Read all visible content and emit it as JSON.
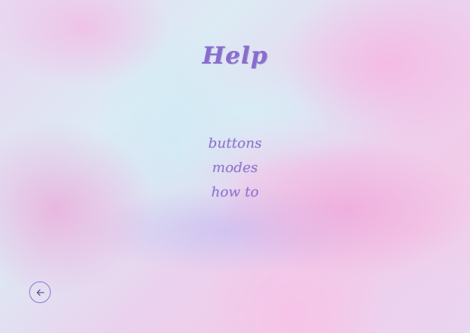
{
  "page": {
    "title": "Help"
  },
  "menu": {
    "items": [
      {
        "label": "buttons"
      },
      {
        "label": "modes"
      },
      {
        "label": "how to"
      }
    ]
  },
  "back_button": {
    "icon": "arrow-left-icon"
  },
  "colors": {
    "accent": "#8a6cd0"
  }
}
